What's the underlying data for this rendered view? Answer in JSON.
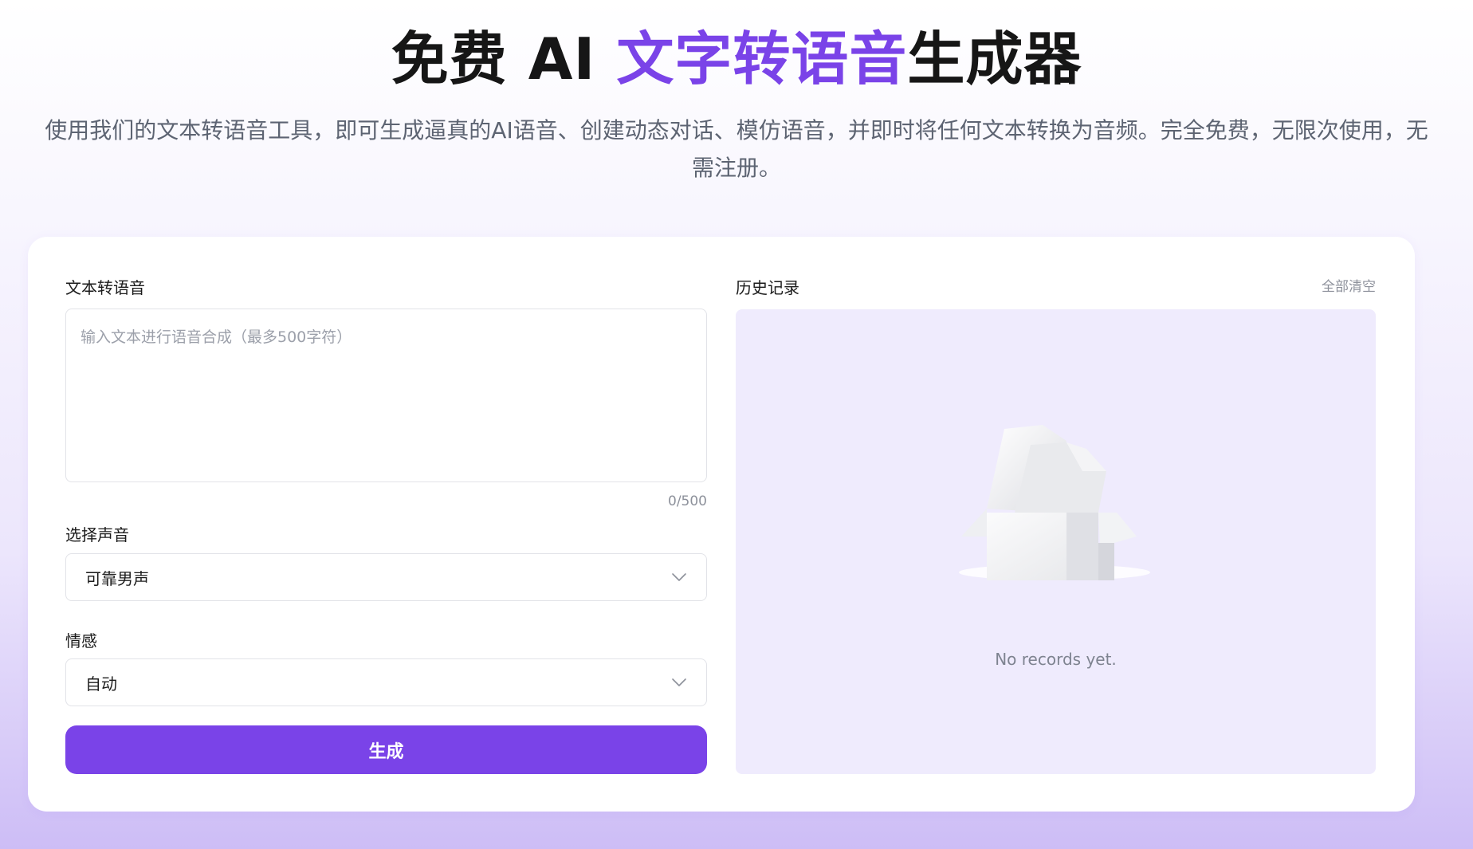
{
  "hero": {
    "title_prefix": "免费 AI ",
    "title_accent": "文字转语音",
    "title_suffix": "生成器",
    "subtitle": "使用我们的文本转语音工具，即可生成逼真的AI语音、创建动态对话、模仿语音，并即时将任何文本转换为音频。完全免费，无限次使用，无需注册。"
  },
  "tts": {
    "section_label": "文本转语音",
    "textarea_placeholder": "输入文本进行语音合成（最多500字符）",
    "textarea_value": "",
    "char_counter": "0/500",
    "voice_label": "选择声音",
    "voice_value": "可靠男声",
    "emotion_label": "情感",
    "emotion_value": "自动",
    "generate_label": "生成"
  },
  "history": {
    "title": "历史记录",
    "clear_all_label": "全部清空",
    "empty_text": "No records yet."
  },
  "icons": {
    "select_chevron": "chevron-down-icon",
    "empty_state": "empty-box-icon"
  },
  "colors": {
    "accent": "#7a43e8",
    "history_bg": "#efebfd",
    "text_primary": "#161616",
    "text_secondary": "#5d6472"
  }
}
